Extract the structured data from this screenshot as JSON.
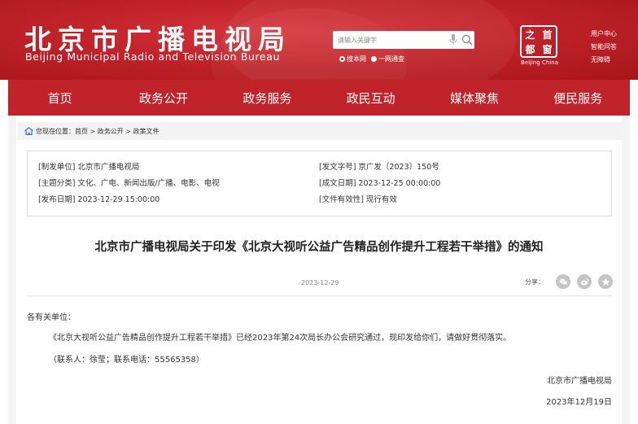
{
  "header": {
    "title_cn": "北京市广播电视局",
    "title_en": "Beijing Municipal Radio and Television Bureau",
    "search_placeholder": "请输入关键字",
    "radio_options": [
      "搜本网",
      "一网通查"
    ],
    "seal_chars": [
      "之",
      "首",
      "都",
      "窗"
    ],
    "seal_caption": "Beijing China",
    "top_links": [
      "用户中心",
      "智能问答",
      "无障碍"
    ]
  },
  "nav": {
    "items": [
      "首页",
      "政务公开",
      "政务服务",
      "政民互动",
      "媒体聚焦",
      "便民服务"
    ]
  },
  "breadcrumb": {
    "text": "您现在位置：首页 > 政务公开 > 政策文件"
  },
  "meta": {
    "issuer": "[制发单位] 北京市广播电视局",
    "doc_no": "[发文字号] 京广发〔2023〕150号",
    "topic": "[主题分类] 文化、广电、新闻出版/广播、电影、电视",
    "created": "[成文日期] 2023-12-25 00:00:00",
    "published": "[发布日期] 2023-12-29 15:00:00",
    "validity": "[文件有效性] 现行有效"
  },
  "document": {
    "title": "北京市广播电视局关于印发《北京大视听公益广告精品创作提升工程若干举措》的通知",
    "date": "2023-12-29",
    "share_label": "分享：",
    "salutation": "各有关单位：",
    "paragraph": "《北京大视听公益广告精品创作提升工程若干举措》已经2023年第24次局长办公会研究通过，现印发给你们，请做好贯彻落实。",
    "contact": "（联系人：徐莹；联系电话：55565358）",
    "signer": "北京市广播电视局",
    "sign_date": "2023年12月19日"
  },
  "colors": {
    "brand_red": "#c1232a",
    "share_grey": "#c4c4c4"
  }
}
